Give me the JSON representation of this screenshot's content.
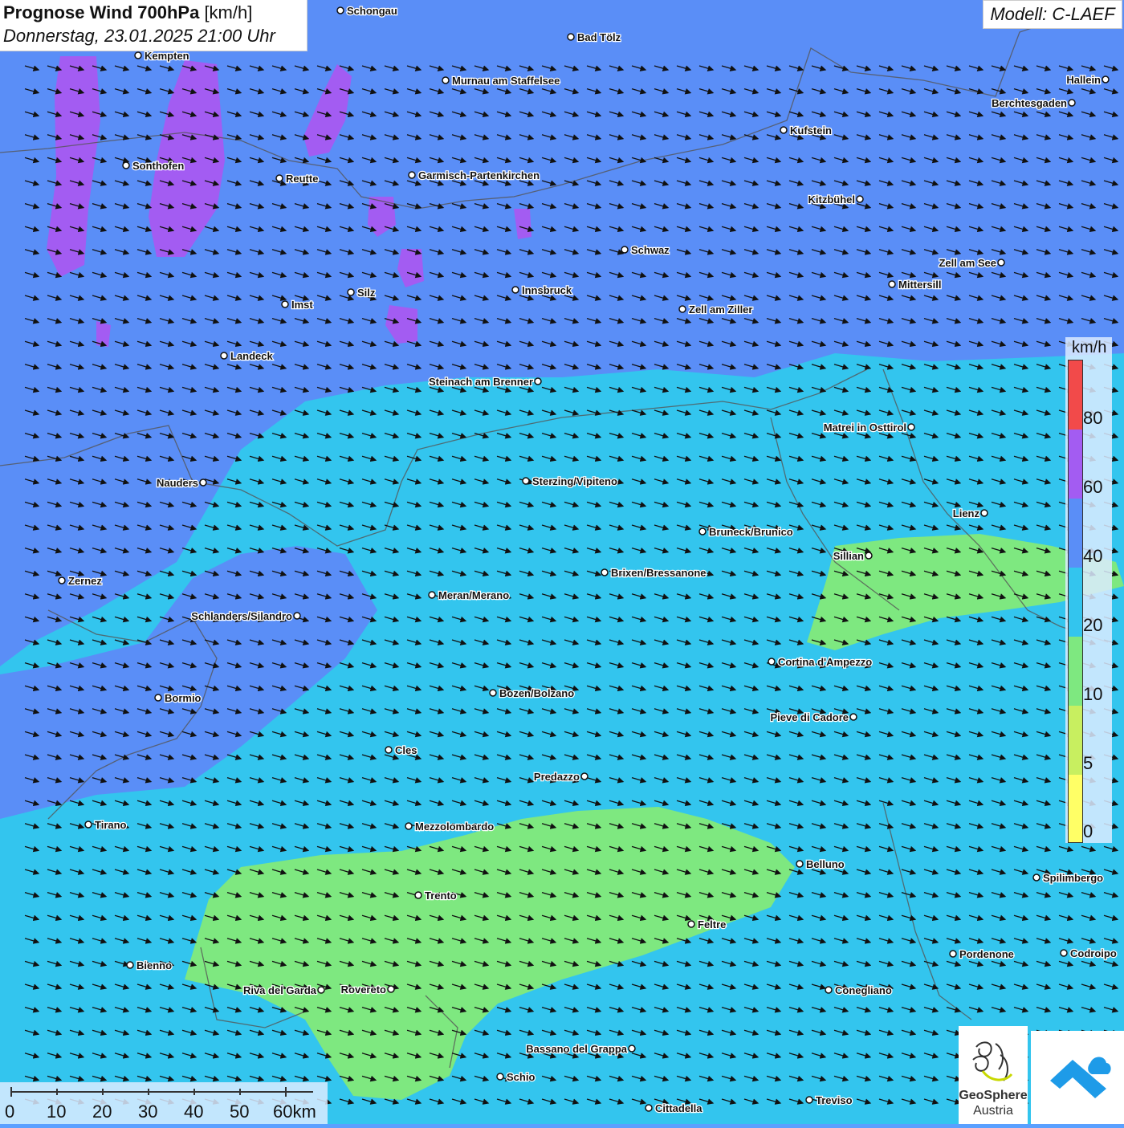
{
  "header": {
    "title": "Prognose Wind 700hPa",
    "title_unit": "[km/h]",
    "subtitle": "Donnerstag, 23.01.2025 21:00 Uhr",
    "model": "Modell: C-LAEF"
  },
  "legend": {
    "unit": "km/h",
    "ticks": [
      "80",
      "60",
      "40",
      "20",
      "10",
      "5",
      "0"
    ],
    "colors": [
      "#f24a4a",
      "#a35cf2",
      "#5a8ef7",
      "#33c5ee",
      "#7ee880",
      "#c8ef60",
      "#ffff66"
    ]
  },
  "scalebar": {
    "labels": [
      "0",
      "10",
      "20",
      "30",
      "40",
      "50",
      "60km"
    ]
  },
  "logos": {
    "geosphere_line1": "GeoSphere",
    "geosphere_line2": "Austria"
  },
  "places": [
    {
      "name": "Schongau"
    },
    {
      "name": "Bad Tölz"
    },
    {
      "name": "Kempten"
    },
    {
      "name": "Murnau am Staffelsee"
    },
    {
      "name": "Hallein"
    },
    {
      "name": "Berchtesgaden"
    },
    {
      "name": "Kufstein"
    },
    {
      "name": "Sonthofen"
    },
    {
      "name": "Reutte"
    },
    {
      "name": "Garmisch-Partenkirchen"
    },
    {
      "name": "Kitzbühel"
    },
    {
      "name": "Schwaz"
    },
    {
      "name": "Zell am See"
    },
    {
      "name": "Innsbruck"
    },
    {
      "name": "Mittersill"
    },
    {
      "name": "Silz"
    },
    {
      "name": "Imst"
    },
    {
      "name": "Zell am Ziller"
    },
    {
      "name": "Landeck"
    },
    {
      "name": "Steinach am Brenner"
    },
    {
      "name": "Matrei in Osttirol"
    },
    {
      "name": "Nauders"
    },
    {
      "name": "Sterzing/Vipiteno"
    },
    {
      "name": "Lienz"
    },
    {
      "name": "Bruneck/Brunico"
    },
    {
      "name": "Sillian"
    },
    {
      "name": "Zernez"
    },
    {
      "name": "Brixen/Bressanone"
    },
    {
      "name": "Meran/Merano"
    },
    {
      "name": "Schlanders/Silandro"
    },
    {
      "name": "Cortina d'Ampezzo"
    },
    {
      "name": "Bozen/Bolzano"
    },
    {
      "name": "Bormio"
    },
    {
      "name": "Pieve di Cadore"
    },
    {
      "name": "Cles"
    },
    {
      "name": "Predazzo"
    },
    {
      "name": "Tirano"
    },
    {
      "name": "Mezzolombardo"
    },
    {
      "name": "Belluno"
    },
    {
      "name": "Spilimbergo"
    },
    {
      "name": "Trento"
    },
    {
      "name": "Feltre"
    },
    {
      "name": "Bienno"
    },
    {
      "name": "Pordenone"
    },
    {
      "name": "Codroipo"
    },
    {
      "name": "Riva del Garda"
    },
    {
      "name": "Rovereto"
    },
    {
      "name": "Conegliano"
    },
    {
      "name": "Bassano del Grappa"
    },
    {
      "name": "Schio"
    },
    {
      "name": "Treviso"
    },
    {
      "name": "Cittadella"
    }
  ]
}
